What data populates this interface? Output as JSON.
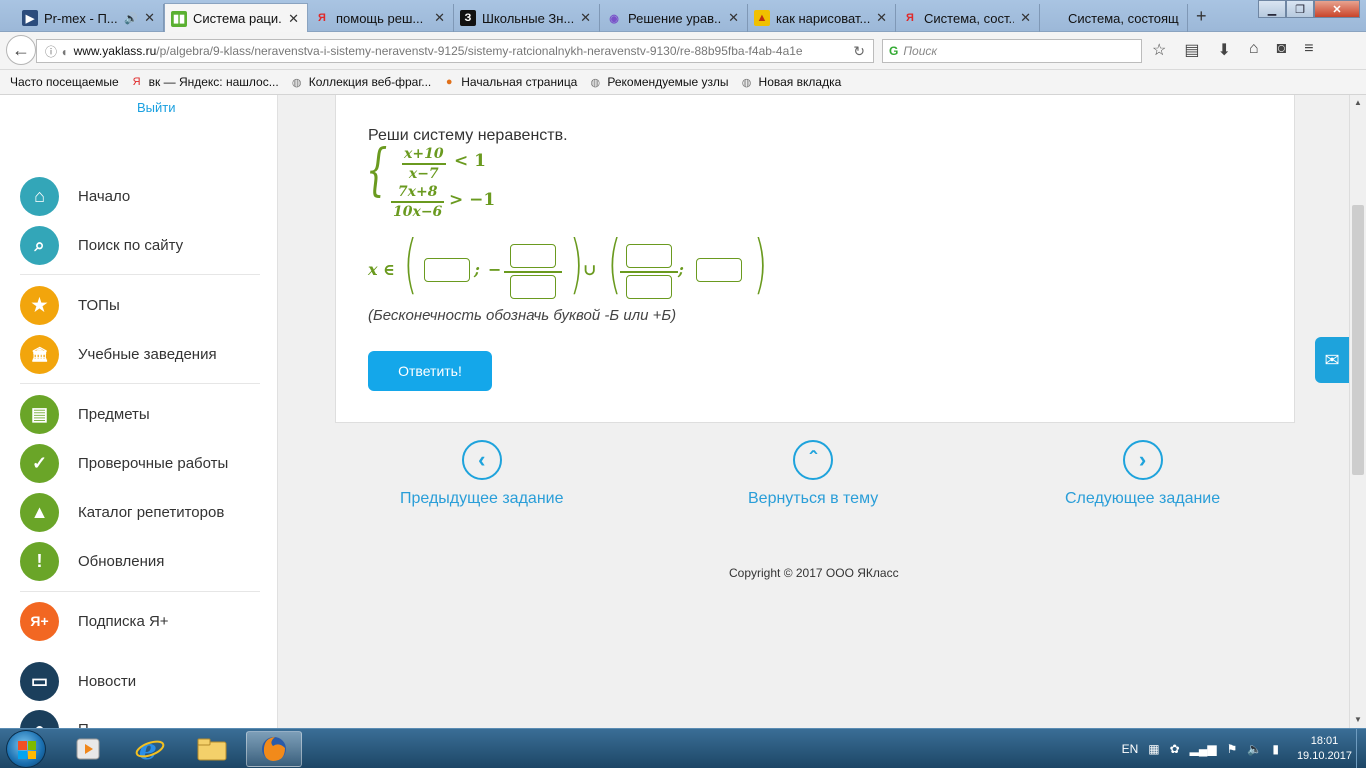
{
  "tabs": [
    {
      "title": "Pr-mex - П...",
      "fav": "▶",
      "fav_bg": "#2c4c7c",
      "fav_color": "#fff",
      "extra": "🔊"
    },
    {
      "title": "Система раци...",
      "fav": "▮▮",
      "fav_bg": "#5ab031",
      "fav_color": "#fff",
      "active": true
    },
    {
      "title": "помощь реш...",
      "fav": "Я",
      "fav_bg": "transparent",
      "fav_color": "#e02a2a"
    },
    {
      "title": "Школьные Зн...",
      "fav": "З",
      "fav_bg": "#111",
      "fav_color": "#fff"
    },
    {
      "title": "Решение урав...",
      "fav": "◉",
      "fav_bg": "transparent",
      "fav_color": "#7a52c9"
    },
    {
      "title": "как нарисоват...",
      "fav": "▲",
      "fav_bg": "#f0c000",
      "fav_color": "#c03010"
    },
    {
      "title": "Система, сост...",
      "fav": "Я",
      "fav_bg": "transparent",
      "fav_color": "#e02a2a"
    },
    {
      "title": "Система, состоящ...",
      "fav": "",
      "fav_bg": "transparent",
      "fav_color": "#000"
    }
  ],
  "url": {
    "host": "www.yaklass.ru",
    "path": "/p/algebra/9-klass/neravenstva-i-sistemy-neravenstv-9125/sistemy-ratcionalnykh-neravenstv-9130/re-88b95fba-f4ab-4a1e"
  },
  "search_placeholder": "Поиск",
  "bookmarks": [
    {
      "label": "Часто посещаемые",
      "icon": "",
      "color": "#999"
    },
    {
      "label": "вк — Яндекс: нашлос...",
      "icon": "Я",
      "color": "#e02a2a"
    },
    {
      "label": "Коллекция веб-фраг...",
      "icon": "◍",
      "color": "#777"
    },
    {
      "label": "Начальная страница",
      "icon": "●",
      "color": "#e0701a"
    },
    {
      "label": "Рекомендуемые узлы",
      "icon": "◍",
      "color": "#777"
    },
    {
      "label": "Новая вкладка",
      "icon": "◍",
      "color": "#777"
    }
  ],
  "sidebar": {
    "logout": "Выйти",
    "items": [
      {
        "label": "Начало",
        "icon": "⌂",
        "color": "#33a6b8",
        "name": "home"
      },
      {
        "label": "Поиск по сайту",
        "icon": "⌕",
        "color": "#33a6b8",
        "name": "search"
      },
      {
        "label": "ТОПы",
        "icon": "★",
        "color": "#f2a50c",
        "name": "tops"
      },
      {
        "label": "Учебные заведения",
        "icon": "🏛",
        "color": "#f2a50c",
        "name": "schools"
      },
      {
        "label": "Предметы",
        "icon": "▤",
        "color": "#6aa528",
        "name": "subjects"
      },
      {
        "label": "Проверочные работы",
        "icon": "✓",
        "color": "#6aa528",
        "name": "tests"
      },
      {
        "label": "Каталог репетиторов",
        "icon": "▲",
        "color": "#6aa528",
        "name": "tutors"
      },
      {
        "label": "Обновления",
        "icon": "!",
        "color": "#6aa528",
        "name": "updates"
      },
      {
        "label": "Подписка Я+",
        "icon": "Я+",
        "color": "#f26722",
        "name": "subscription"
      },
      {
        "label": "Новости",
        "icon": "▭",
        "color": "#1b3f5c",
        "name": "news"
      },
      {
        "label": "П...",
        "icon": "●",
        "color": "#1b3f5c",
        "name": "partial"
      }
    ]
  },
  "task": {
    "title": "Реши систему неравенств.",
    "eq1": {
      "num": "x+10",
      "den": "x−7",
      "rel": "< 1"
    },
    "eq2": {
      "num": "7x+8",
      "den": "10x−6",
      "rel": "> −1"
    },
    "answer_prefix": "x ∈",
    "semicolon": ";",
    "minus": "−",
    "union": "∪",
    "hint": "(Бесконечность обозначь буквой -Б или +Б)",
    "submit": "Ответить!"
  },
  "nav": {
    "prev": "Предыдущее задание",
    "back": "Вернуться в тему",
    "next": "Следующее задание"
  },
  "copyright": "Copyright © 2017 ООО ЯКласс",
  "taskbar": {
    "lang": "EN",
    "time": "18:01",
    "date": "19.10.2017"
  }
}
